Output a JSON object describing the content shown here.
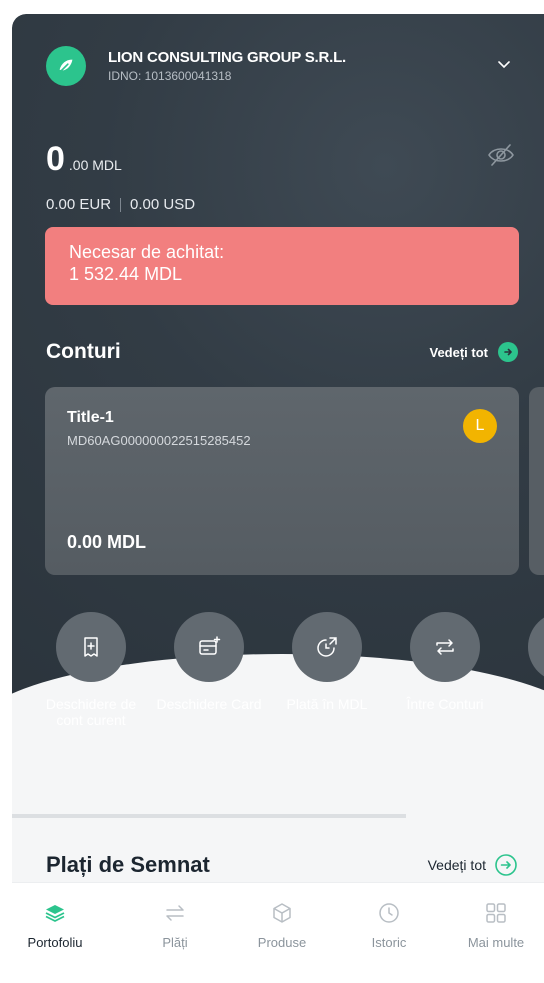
{
  "company": {
    "name": "LION CONSULTING GROUP S.R.L.",
    "idno": "IDNO: 1013600041318"
  },
  "balance": {
    "main": "0",
    "decimals": ".00 MDL",
    "eur": "0.00 EUR",
    "usd": "0.00 USD"
  },
  "due": {
    "line1": "Necesar de achitat:",
    "line2": "1 532.44 MDL"
  },
  "accounts": {
    "title": "Conturi",
    "see_all": "Vedeți tot"
  },
  "card": {
    "title": "Title-1",
    "iban": "MD60AG000000022515285452",
    "avatar": "L",
    "amount": "0.00 MDL"
  },
  "actions": [
    {
      "label": "Deschidere de cont curent",
      "icon": "add-document-icon"
    },
    {
      "label": "Deschidere Card",
      "icon": "card-add-icon"
    },
    {
      "label": "Plată în MDL",
      "icon": "payment-arrow-icon"
    },
    {
      "label": "Între Conturi",
      "icon": "transfer-icon"
    }
  ],
  "sign": {
    "title": "Plați de Semnat",
    "see_all": "Vedeți tot"
  },
  "tabs": [
    {
      "label": "Portofoliu",
      "icon": "layers-icon",
      "active": true
    },
    {
      "label": "Plăți",
      "icon": "transfer-icon",
      "active": false
    },
    {
      "label": "Produse",
      "icon": "box-icon",
      "active": false
    },
    {
      "label": "Istoric",
      "icon": "clock-icon",
      "active": false
    },
    {
      "label": "Mai multe",
      "icon": "grid-icon",
      "active": false
    }
  ],
  "colors": {
    "accent": "#2cc48d",
    "due": "#f27f7f",
    "avatar": "#f2b400",
    "hero": "#323c45"
  }
}
